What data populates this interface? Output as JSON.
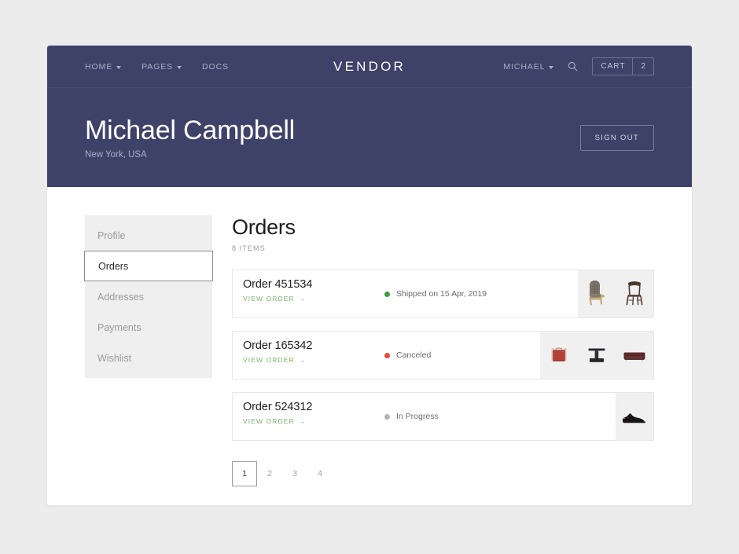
{
  "navbar": {
    "links": [
      {
        "label": "HOME",
        "has_caret": true
      },
      {
        "label": "PAGES",
        "has_caret": true
      },
      {
        "label": "DOCS",
        "has_caret": false
      }
    ],
    "brand": "VENDOR",
    "account": "MICHAEL",
    "search_icon": "search-icon",
    "cart_label": "CART",
    "cart_count": "2"
  },
  "hero": {
    "name": "Michael Campbell",
    "location": "New York, USA",
    "signout_label": "SIGN OUT",
    "background_color": "#3e4269"
  },
  "sidebar": {
    "items": [
      {
        "label": "Profile",
        "active": false
      },
      {
        "label": "Orders",
        "active": true
      },
      {
        "label": "Addresses",
        "active": false
      },
      {
        "label": "Payments",
        "active": false
      },
      {
        "label": "Wishlist",
        "active": false
      }
    ]
  },
  "main": {
    "title": "Orders",
    "count_label": "8 ITEMS",
    "view_order_label": "VIEW ORDER",
    "view_order_arrow": "→",
    "orders": [
      {
        "id": "Order 451534",
        "status": "Shipped on 15 Apr, 2019",
        "status_color": "#3f9c42",
        "thumbs": [
          "armchair",
          "dining-chair"
        ]
      },
      {
        "id": "Order 165342",
        "status": "Canceled",
        "status_color": "#e94b35",
        "thumbs": [
          "red-suitcase",
          "black-side-table",
          "dark-red-sofa"
        ]
      },
      {
        "id": "Order 524312",
        "status": "In Progress",
        "status_color": "#b4b4b4",
        "thumbs": [
          "black-sneaker"
        ]
      }
    ]
  },
  "pagination": {
    "pages": [
      "1",
      "2",
      "3",
      "4"
    ],
    "active": "1"
  },
  "colors": {
    "navy": "#3e4269",
    "page_bg": "#ececec",
    "sidebar_bg": "#efefef",
    "link_green": "#79b36a",
    "thumb_bg": "#f0f0f0"
  }
}
